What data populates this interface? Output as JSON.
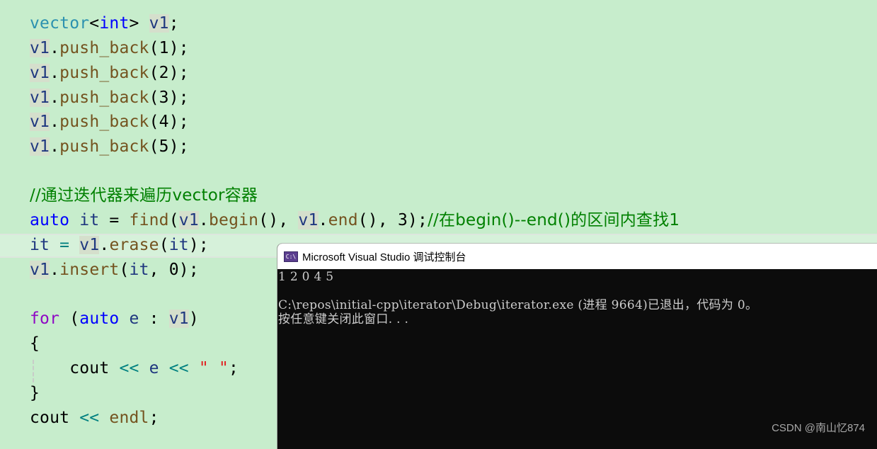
{
  "editor": {
    "lines": {
      "l1": {
        "a": "vector",
        "b": "<",
        "c": "int",
        "d": "> ",
        "e": "v1",
        "f": ";"
      },
      "l2": {
        "a": "v1",
        "b": ".",
        "c": "push_back",
        "d": "(1);"
      },
      "l3": {
        "a": "v1",
        "b": ".",
        "c": "push_back",
        "d": "(2);"
      },
      "l4": {
        "a": "v1",
        "b": ".",
        "c": "push_back",
        "d": "(3);"
      },
      "l5": {
        "a": "v1",
        "b": ".",
        "c": "push_back",
        "d": "(4);"
      },
      "l6": {
        "a": "v1",
        "b": ".",
        "c": "push_back",
        "d": "(5);"
      },
      "l7": {
        "comment": "//通过迭代器来遍历vector容器"
      },
      "l8": {
        "a": "auto",
        "b": " ",
        "c": "it",
        "d": " = ",
        "e": "find",
        "f": "(",
        "g": "v1",
        "h": ".",
        "i": "begin",
        "j": "(), ",
        "k": "v1",
        "l": ".",
        "m": "end",
        "n": "(), 3);",
        "comment": "//在begin()--end()的区间内查找1"
      },
      "l9": {
        "a": "it",
        "b": " = ",
        "c": "v1",
        "d": ".",
        "e": "erase",
        "f": "(",
        "g": "it",
        "h": ");"
      },
      "l10": {
        "a": "v1",
        "b": ".",
        "c": "insert",
        "d": "(",
        "e": "it",
        "f": ", 0);"
      },
      "l11": {
        "a": "for",
        "b": " (",
        "c": "auto",
        "d": " ",
        "e": "e",
        "f": " : ",
        "g": "v1",
        "h": ")"
      },
      "l12": {
        "a": "{"
      },
      "l13": {
        "a": "    cout",
        "b": " << ",
        "c": "e",
        "d": " << ",
        "e": "\" \"",
        "f": ";"
      },
      "l14": {
        "a": "}"
      },
      "l15": {
        "a": "cout",
        "b": " << ",
        "c": "endl",
        "d": ";"
      }
    }
  },
  "console": {
    "icon_label": "C:\\",
    "title": "Microsoft Visual Studio 调试控制台",
    "output": [
      "1 2 0 4 5",
      "",
      "C:\\repos\\initial-cpp\\iterator\\Debug\\iterator.exe (进程 9664)已退出，代码为 0。",
      "按任意键关闭此窗口. . ."
    ]
  },
  "watermark": "CSDN @南山忆874"
}
